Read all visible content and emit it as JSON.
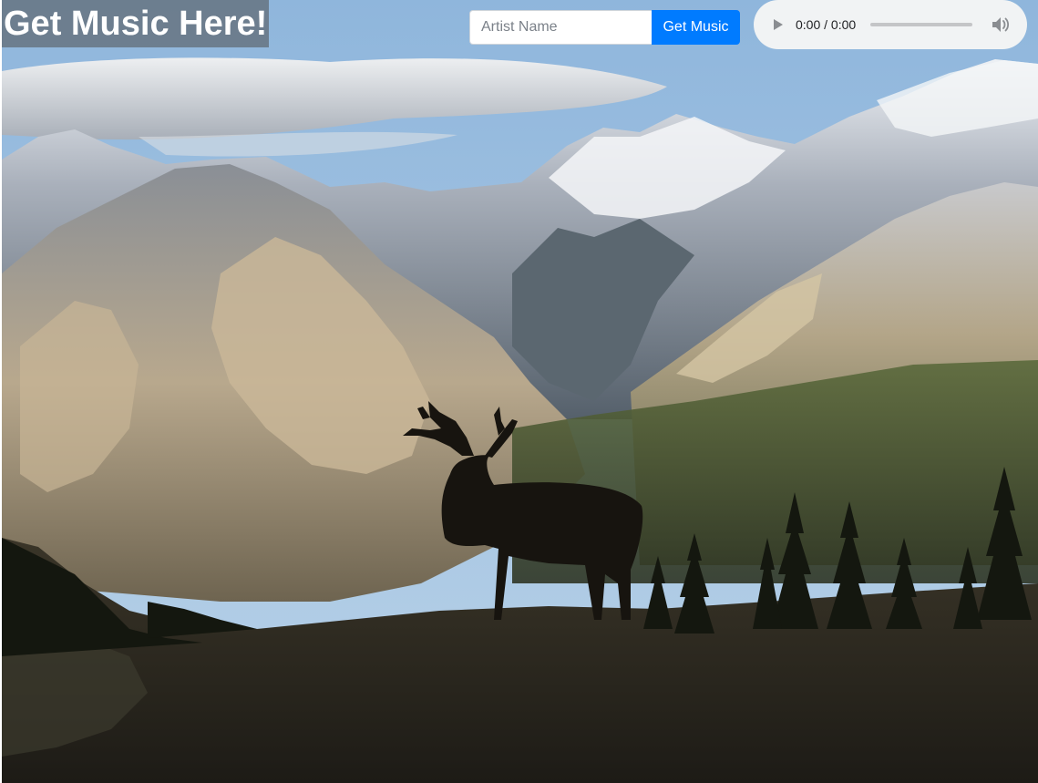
{
  "header": {
    "title": "Get Music Here!"
  },
  "search": {
    "placeholder": "Artist Name",
    "value": "",
    "button_label": "Get Music"
  },
  "player": {
    "current_time": "0:00",
    "duration": "0:00",
    "time_display": "0:00 / 0:00",
    "progress": 0,
    "play_icon": "play-icon",
    "volume_icon": "volume-icon"
  },
  "colors": {
    "button_primary": "#007bff",
    "title_background": "#687684",
    "player_background": "#f1f3f4"
  },
  "background": {
    "icon": "mountain-elk-landscape"
  }
}
